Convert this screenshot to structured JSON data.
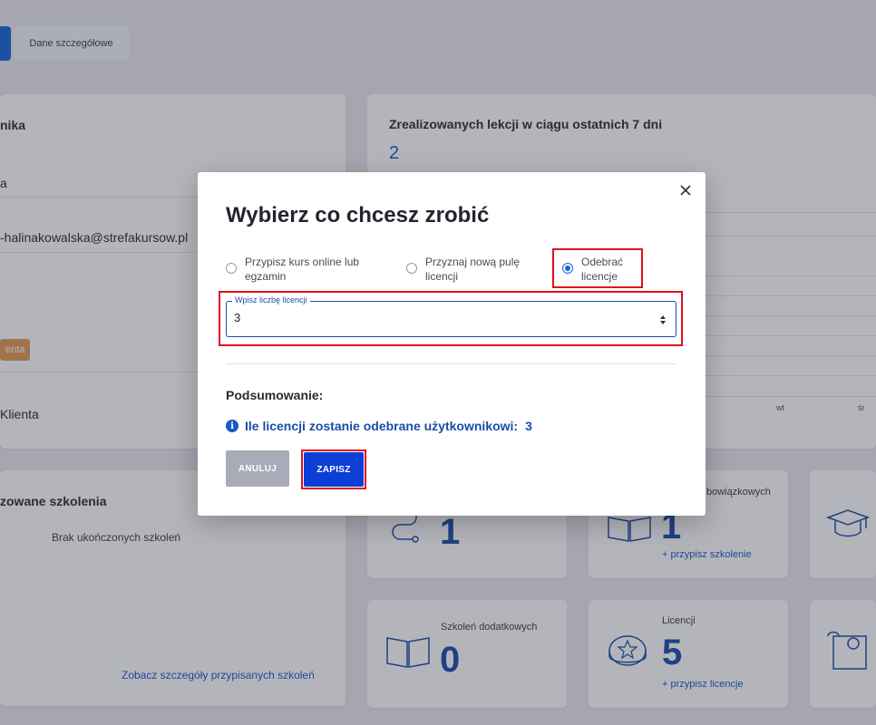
{
  "tabs": {
    "details": "Dane szczegółowe"
  },
  "left_panel": {
    "title_partial": "nika",
    "name_partial": "a",
    "email_partial": "-halinakowalska@strefakursow.pl",
    "badge_partial": "enta",
    "client_partial": "Klienta"
  },
  "lessons_panel": {
    "title": "Zrealizowanych lekcji w ciągu ostatnich 7 dni",
    "value": "2",
    "x_labels": [
      "wt",
      "śr"
    ]
  },
  "trainings_panel": {
    "title_partial": "zowane szkolenia",
    "empty": "Brak ukończonych szkoleń",
    "link": "Zobacz szczegóły przypisanych szkoleń"
  },
  "stats": {
    "path_value": "1",
    "mandatory_label_partial": "bowiązkowych",
    "mandatory_value": "1",
    "mandatory_link": "+ przypisz szkolenie",
    "additional_label": "Szkoleń dodatkowych",
    "additional_value": "0",
    "licenses_label": "Licencji",
    "licenses_value": "5",
    "licenses_link": "+ przypisz licencje"
  },
  "modal": {
    "title": "Wybierz co chcesz zrobić",
    "options": [
      {
        "line1": "Przypisz kurs online lub",
        "line2": "egzamin",
        "selected": false
      },
      {
        "line1": "Przyznaj nową pulę",
        "line2": "licencji",
        "selected": false
      },
      {
        "line1": "Odebrać",
        "line2": "licencje",
        "selected": true
      }
    ],
    "field_label": "Wpisz liczbę licencji",
    "field_value": "3",
    "summary_title": "Podsumowanie:",
    "summary_text": "Ile licencji zostanie odebrane użytkownikowi:",
    "summary_value": "3",
    "cancel_label": "ANULUJ",
    "save_label": "ZAPISZ"
  },
  "colors": {
    "primary": "#1665d8",
    "accent_dark": "#1a4ea8",
    "highlight": "#e0101c",
    "cancel": "#a9abb8",
    "badge": "#e49a52"
  }
}
